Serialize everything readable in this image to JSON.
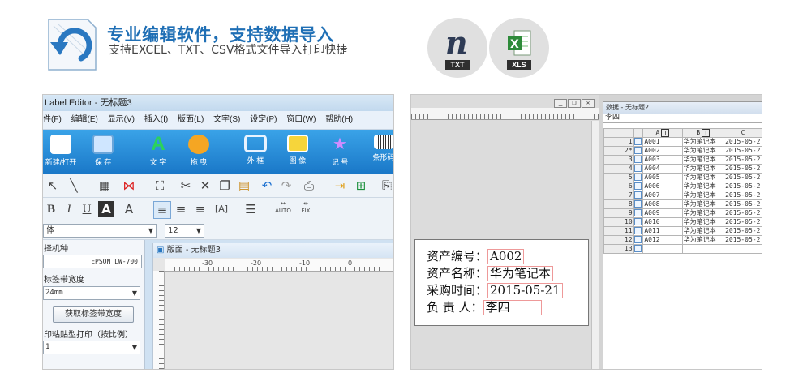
{
  "header": {
    "title": "专业编辑软件，支持数据导入",
    "subtitle": "支持EXCEL、TXT、CSV格式文件导入打印快捷",
    "formats": [
      {
        "label": "TXT",
        "icon": "notepad-icon"
      },
      {
        "label": "XLS",
        "icon": "excel-icon"
      }
    ]
  },
  "left": {
    "window_title": "Label Editor - 无标题3",
    "menu": [
      "件(F)",
      "编辑(E)",
      "显示(V)",
      "插入(I)",
      "版面(L)",
      "文字(S)",
      "设定(P)",
      "窗口(W)",
      "帮助(H)"
    ],
    "ribbon": [
      {
        "label": "新建/打开",
        "color": "#ffffff"
      },
      {
        "label": "保 存",
        "color": "#cfe6ff"
      },
      {
        "label": "文 字",
        "color": "#27c24c"
      },
      {
        "label": "拖 曳",
        "color": "#f5a623"
      },
      {
        "label": "外 框",
        "color": "#dbeeff"
      },
      {
        "label": "图 像",
        "color": "#f6d53b"
      },
      {
        "label": "记 号",
        "color": "#d08cff"
      },
      {
        "label": "条形码",
        "color": "#eeeeee"
      }
    ],
    "toolbar2_glyphs": [
      "B",
      "I",
      "U",
      "A"
    ],
    "toolbar2_small": [
      "AUTO",
      "FIX"
    ],
    "font_name": "体",
    "font_size": "12",
    "printer_label": "择机种",
    "printer_model": "EPSON LW-700",
    "tape_label": "标签带宽度",
    "tape_width": "24mm",
    "get_width_button": "获取标签带宽度",
    "print_mode_label": "印粘贴型打印（按比例）",
    "print_mode_value": "1",
    "doc_tab": "版面 - 无标题3",
    "ruler_marks": [
      "-30",
      "-20",
      "-10",
      "0"
    ]
  },
  "right": {
    "grid_title": "数据 - 无标题2",
    "edit_value": "李四",
    "columns": [
      "A",
      "B",
      "C"
    ],
    "rows": [
      {
        "n": "1",
        "a": "A001",
        "b": "华为笔记本",
        "c": "2015-05-2"
      },
      {
        "n": "2*",
        "a": "A002",
        "b": "华为笔记本",
        "c": "2015-05-2"
      },
      {
        "n": "3",
        "a": "A003",
        "b": "华为笔记本",
        "c": "2015-05-2"
      },
      {
        "n": "4",
        "a": "A004",
        "b": "华为笔记本",
        "c": "2015-05-2"
      },
      {
        "n": "5",
        "a": "A005",
        "b": "华为笔记本",
        "c": "2015-05-2"
      },
      {
        "n": "6",
        "a": "A006",
        "b": "华为笔记本",
        "c": "2015-05-2"
      },
      {
        "n": "7",
        "a": "A007",
        "b": "华为笔记本",
        "c": "2015-05-2"
      },
      {
        "n": "8",
        "a": "A008",
        "b": "华为笔记本",
        "c": "2015-05-2"
      },
      {
        "n": "9",
        "a": "A009",
        "b": "华为笔记本",
        "c": "2015-05-2"
      },
      {
        "n": "10",
        "a": "A010",
        "b": "华为笔记本",
        "c": "2015-05-2"
      },
      {
        "n": "11",
        "a": "A011",
        "b": "华为笔记本",
        "c": "2015-05-2"
      },
      {
        "n": "12",
        "a": "A012",
        "b": "华为笔记本",
        "c": "2015-05-2"
      },
      {
        "n": "13",
        "a": "",
        "b": "",
        "c": ""
      }
    ],
    "label_fields": [
      {
        "key": "资产编号：",
        "value": "A002"
      },
      {
        "key": "资产名称：",
        "value": "华为笔记本"
      },
      {
        "key": "采购时间：",
        "value": "2015-05-21"
      },
      {
        "key": "负 责 人：",
        "value": "李四"
      }
    ]
  }
}
